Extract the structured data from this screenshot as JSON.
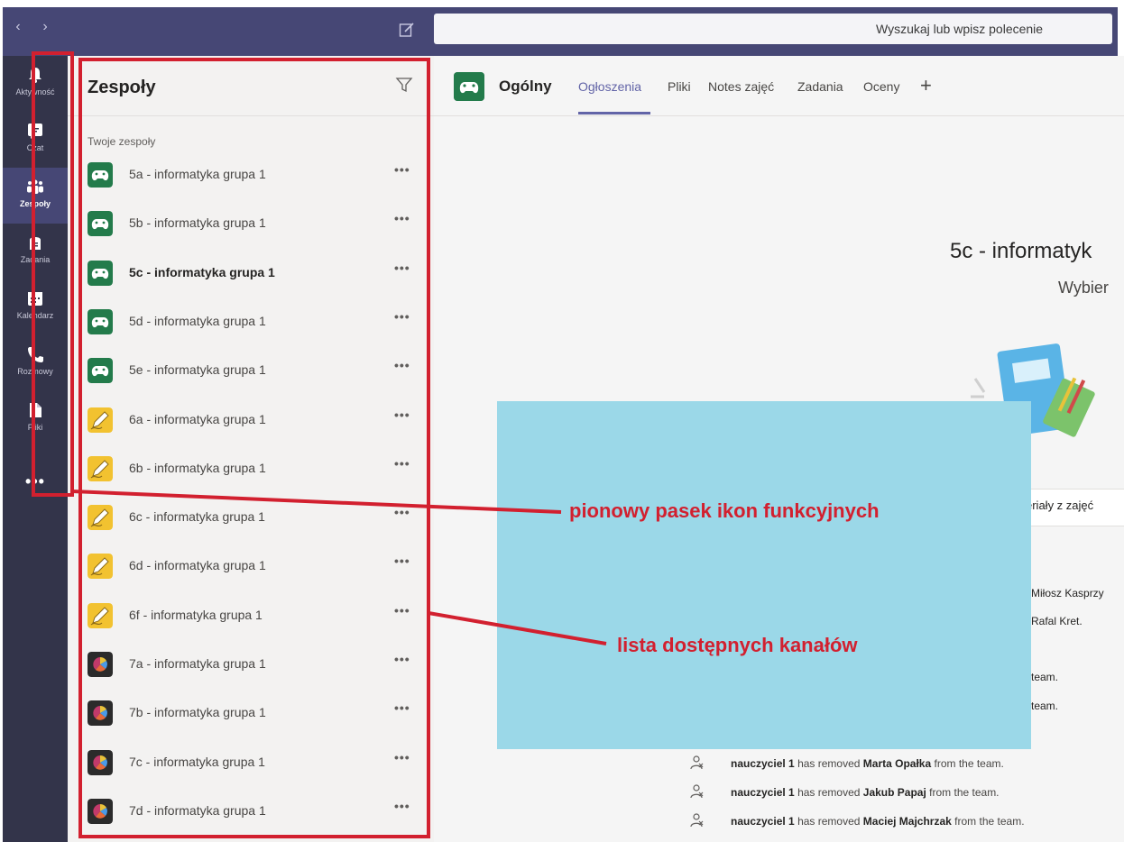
{
  "topbar": {
    "back_icon": "chevron-left-icon",
    "forward_icon": "chevron-right-icon",
    "compose_icon": "compose-icon",
    "search_placeholder": "Wyszukaj lub wpisz polecenie"
  },
  "rail": {
    "items": [
      {
        "label": "Aktywność",
        "icon": "bell-icon"
      },
      {
        "label": "Czat",
        "icon": "chat-icon"
      },
      {
        "label": "Zespoły",
        "icon": "teams-icon",
        "active": true
      },
      {
        "label": "Zadania",
        "icon": "assignments-icon"
      },
      {
        "label": "Kalendarz",
        "icon": "calendar-icon"
      },
      {
        "label": "Rozmowy",
        "icon": "phone-icon"
      },
      {
        "label": "Pliki",
        "icon": "file-icon"
      }
    ],
    "more": "•••"
  },
  "teams": {
    "title": "Zespoły",
    "filter_icon": "filter-icon",
    "section_label": "Twoje zespoły",
    "more_label": "•••",
    "list": [
      {
        "name": "5a - informatyka grupa 1",
        "icon": "gamepad-icon"
      },
      {
        "name": "5b - informatyka grupa 1",
        "icon": "gamepad-icon"
      },
      {
        "name": "5c - informatyka grupa 1",
        "icon": "gamepad-icon",
        "selected": true
      },
      {
        "name": "5d - informatyka grupa 1",
        "icon": "gamepad-icon"
      },
      {
        "name": "5e - informatyka grupa 1",
        "icon": "gamepad-icon"
      },
      {
        "name": "6a - informatyka grupa 1",
        "icon": "pencil-icon"
      },
      {
        "name": "6b - informatyka grupa 1",
        "icon": "pencil-icon"
      },
      {
        "name": "6c - informatyka grupa 1",
        "icon": "pencil-icon"
      },
      {
        "name": "6d - informatyka grupa 1",
        "icon": "pencil-icon"
      },
      {
        "name": "6f - informatyka grupa 1",
        "icon": "pencil-icon"
      },
      {
        "name": "7a - informatyka grupa 1",
        "icon": "color-wheel-icon"
      },
      {
        "name": "7b - informatyka grupa 1",
        "icon": "color-wheel-icon"
      },
      {
        "name": "7c - informatyka grupa 1",
        "icon": "color-wheel-icon"
      },
      {
        "name": "7d - informatyka grupa 1",
        "icon": "color-wheel-icon"
      }
    ]
  },
  "channel": {
    "name": "Ogólny",
    "tabs": [
      "Ogłoszenia",
      "Pliki",
      "Notes zajęć",
      "Zadania",
      "Oceny"
    ],
    "add_tab": "+",
    "hero_title": "5c - informatyk",
    "hero_subtitle": "Wybier",
    "materials_label": "eriały z zajęć",
    "side_lines": [
      "Miłosz Kasprzy",
      "Rafal Kret.",
      "team.",
      "team."
    ],
    "activity": [
      {
        "actor": "nauczyciel 1",
        "verb": "has removed",
        "subject": "Marta Opałka",
        "tail": "from the team."
      },
      {
        "actor": "nauczyciel 1",
        "verb": "has removed",
        "subject": "Jakub Papaj",
        "tail": "from the team."
      },
      {
        "actor": "nauczyciel 1",
        "verb": "has removed",
        "subject": "Maciej Majchrzak",
        "tail": "from the team."
      }
    ]
  },
  "annotations": {
    "rail_label": "pionowy pasek ikon funkcyjnych",
    "list_label": "lista dostępnych kanałów",
    "color": "#d2202f"
  },
  "colors": {
    "brand": "#464775",
    "rail": "#33344a",
    "accent": "#6264a7",
    "team_green": "#237b4b",
    "team_yellow": "#f2c230",
    "team_dark": "#2b2b2b",
    "overlay_cyan": "#9bd8e8"
  }
}
